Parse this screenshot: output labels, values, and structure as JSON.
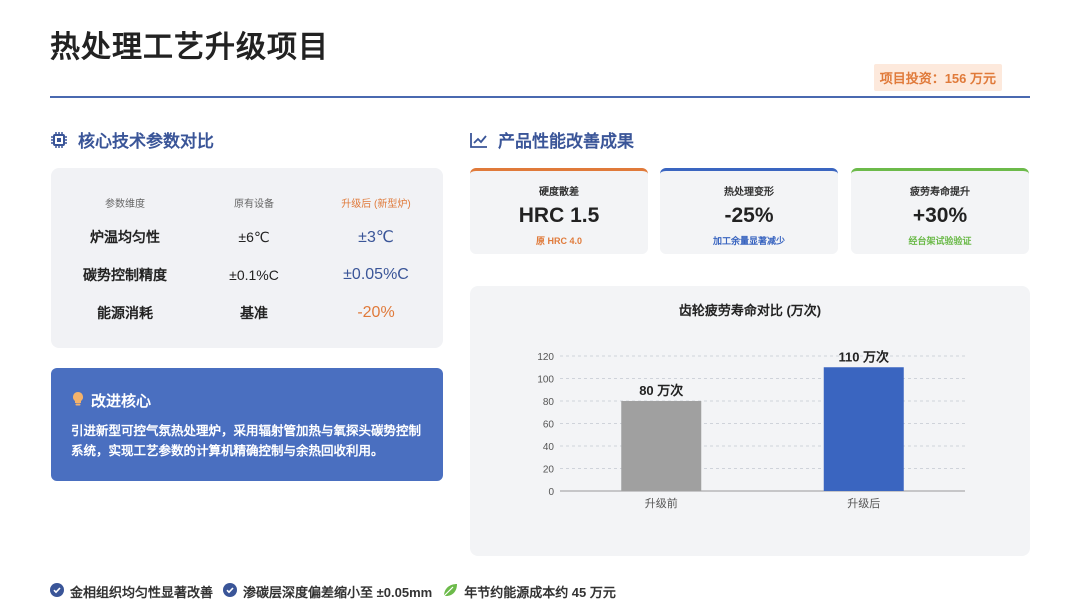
{
  "title": "热处理工艺升级项目",
  "investment": "项目投资：156 万元",
  "left_section": {
    "heading": "核心技术参数对比",
    "icon": "chip-icon",
    "headers": [
      "参数维度",
      "原有设备",
      "升级后 (新型炉)"
    ],
    "rows": [
      {
        "param": "炉温均匀性",
        "old": "±6℃",
        "new": "±3℃"
      },
      {
        "param": "碳势控制精度",
        "old": "±0.1%C",
        "new": "±0.05%C"
      },
      {
        "param": "能源消耗",
        "old": "基准",
        "new": "-20%"
      }
    ]
  },
  "core": {
    "icon": "lightbulb-icon",
    "title": "改进核心",
    "text": "引进新型可控气氛热处理炉，采用辐射管加热与氧探头碳势控制系统，实现工艺参数的计算机精确控制与余热回收利用。"
  },
  "right_section": {
    "heading": "产品性能改善成果",
    "icon": "line-chart-icon",
    "metrics": [
      {
        "label": "硬度散差",
        "value": "HRC 1.5",
        "sub": "原 HRC 4.0",
        "color": "#e07a3a"
      },
      {
        "label": "热处理变形",
        "value": "-25%",
        "sub": "加工余量显著减少",
        "color": "#3a65c0"
      },
      {
        "label": "疲劳寿命提升",
        "value": "+30%",
        "sub": "经台架试验验证",
        "color": "#6cba4a"
      }
    ]
  },
  "chart_title": "齿轮疲劳寿命对比 (万次)",
  "chart_data": {
    "type": "bar",
    "title": "齿轮疲劳寿命对比 (万次)",
    "categories": [
      "升级前",
      "升级后"
    ],
    "values": [
      80,
      110
    ],
    "data_labels": [
      "80 万次",
      "110 万次"
    ],
    "colors": [
      "#a0a0a0",
      "#3a65c0"
    ],
    "ylim": [
      0,
      120
    ],
    "yticks": [
      0,
      20,
      40,
      60,
      80,
      100,
      120
    ],
    "grid": true
  },
  "footer": [
    {
      "icon": "check-circle-icon",
      "text": "金相组织均匀性显著改善"
    },
    {
      "icon": "check-circle-icon",
      "text": "渗碳层深度偏差缩小至 ±0.05mm"
    },
    {
      "icon": "leaf-icon",
      "text": "年节约能源成本约 45 万元"
    }
  ]
}
